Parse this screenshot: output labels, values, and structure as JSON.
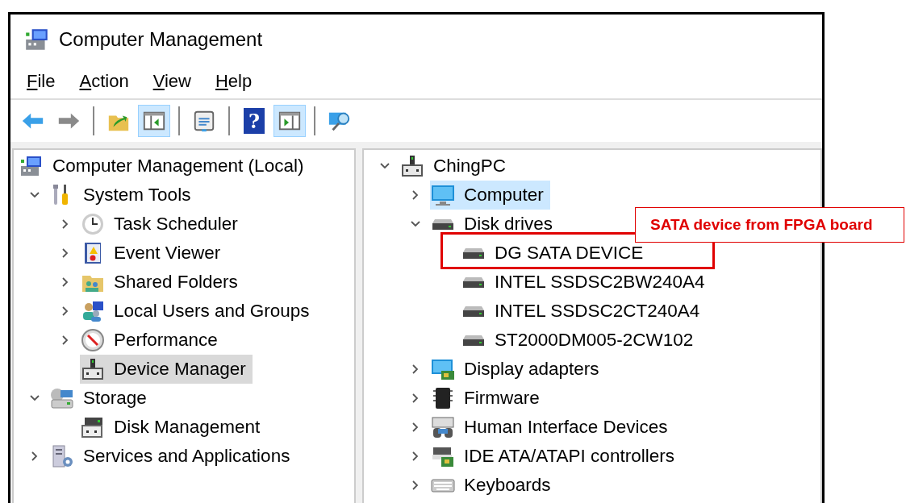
{
  "window": {
    "title": "Computer Management"
  },
  "menu": [
    "File",
    "Action",
    "View",
    "Help"
  ],
  "toolbar": [
    {
      "kind": "button",
      "pressed": false
    },
    {
      "kind": "button",
      "pressed": false
    },
    {
      "kind": "separator"
    },
    {
      "kind": "button",
      "pressed": false
    },
    {
      "kind": "button",
      "pressed": true
    },
    {
      "kind": "separator"
    },
    {
      "kind": "button",
      "pressed": false
    },
    {
      "kind": "separator"
    },
    {
      "kind": "button",
      "pressed": false,
      "glyph": "?"
    },
    {
      "kind": "button",
      "pressed": true
    },
    {
      "kind": "separator"
    },
    {
      "kind": "button",
      "pressed": false
    }
  ],
  "left_pane": {
    "focused": false,
    "tree": [
      {
        "label": "Computer Management (Local)",
        "selected": false,
        "children": [
          {
            "label": "System Tools",
            "selected": false,
            "expanded": true,
            "children": [
              {
                "label": "Task Scheduler",
                "selected": false,
                "expanded": false
              },
              {
                "label": "Event Viewer",
                "selected": false,
                "expanded": false
              },
              {
                "label": "Shared Folders",
                "selected": false,
                "expanded": false
              },
              {
                "label": "Local Users and Groups",
                "selected": false,
                "expanded": false
              },
              {
                "label": "Performance",
                "selected": false,
                "expanded": false
              },
              {
                "label": "Device Manager",
                "selected": true
              }
            ]
          },
          {
            "label": "Storage",
            "selected": false,
            "expanded": true,
            "children": [
              {
                "label": "Disk Management",
                "selected": false
              }
            ]
          },
          {
            "label": "Services and Applications",
            "selected": false,
            "expanded": false
          }
        ]
      }
    ]
  },
  "right_pane": {
    "focused": true,
    "tree": [
      {
        "label": "ChingPC",
        "selected": false,
        "expanded": true,
        "children": [
          {
            "label": "Computer",
            "selected": true,
            "expanded": false
          },
          {
            "label": "Disk drives",
            "selected": false,
            "expanded": true,
            "children": [
              {
                "label": "DG SATA DEVICE",
                "selected": false
              },
              {
                "label": "INTEL SSDSC2BW240A4",
                "selected": false
              },
              {
                "label": "INTEL SSDSC2CT240A4",
                "selected": false
              },
              {
                "label": "ST2000DM005-2CW102",
                "selected": false
              }
            ]
          },
          {
            "label": "Display adapters",
            "selected": false,
            "expanded": false
          },
          {
            "label": "Firmware",
            "selected": false,
            "expanded": false
          },
          {
            "label": "Human Interface Devices",
            "selected": false,
            "expanded": false
          },
          {
            "label": "IDE ATA/ATAPI controllers",
            "selected": false,
            "expanded": false
          },
          {
            "label": "Keyboards",
            "selected": false,
            "expanded": false
          }
        ]
      }
    ]
  },
  "annotation": {
    "label": "SATA device from FPGA board"
  }
}
